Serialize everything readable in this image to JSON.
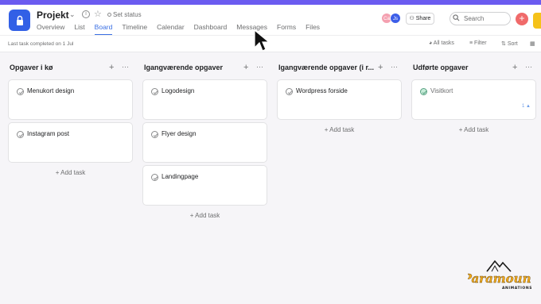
{
  "project": {
    "title": "Projekt",
    "status": "Set status"
  },
  "tabs": [
    "Overview",
    "List",
    "Board",
    "Timeline",
    "Calendar",
    "Dashboard",
    "Messages",
    "Forms",
    "Files"
  ],
  "active_tab": "Board",
  "header": {
    "avatars": [
      {
        "initials": "Ca",
        "color": "#f4a0b0"
      },
      {
        "initials": "Js",
        "color": "#3d5ee8"
      }
    ],
    "share_label": "Share",
    "search_placeholder": "Search"
  },
  "toolbar": {
    "last_task": "Last task completed on 1 Jul",
    "all_tasks": "All tasks",
    "filter": "Filter",
    "sort": "Sort"
  },
  "columns": [
    {
      "title": "Opgaver i kø",
      "cards": [
        {
          "title": "Menukort design",
          "done": false
        },
        {
          "title": "Instagram post",
          "done": false
        }
      ],
      "add_label": "Add task"
    },
    {
      "title": "Igangværende opgaver",
      "cards": [
        {
          "title": "Logodesign",
          "done": false
        },
        {
          "title": "Flyer design",
          "done": false
        },
        {
          "title": "Landingpage",
          "done": false
        }
      ],
      "add_label": "Add task"
    },
    {
      "title": "Igangværende opgaver (i r...",
      "cards": [
        {
          "title": "Wordpress forside",
          "done": false
        }
      ],
      "add_label": "Add task"
    },
    {
      "title": "Udførte opgaver",
      "cards": [
        {
          "title": "Visitkort",
          "done": true,
          "likes": "1"
        }
      ],
      "add_label": "Add task"
    }
  ],
  "watermark": {
    "brand": "Paramount",
    "sub": "ANIMATIONS"
  },
  "colors": {
    "accent": "#3a6fe3",
    "topbar": "#6b5bf0",
    "app_icon": "#3260e6",
    "add_button": "#f06a6a",
    "done_check": "#58a182"
  }
}
